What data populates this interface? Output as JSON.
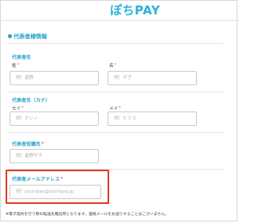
{
  "header": {
    "logo_text": "ぽちPAY"
  },
  "section": {
    "title": "代表者様情報"
  },
  "groups": {
    "name": {
      "label": "代表者名",
      "last": {
        "label": "姓",
        "required_mark": "*",
        "placeholder": "例）星野"
      },
      "first": {
        "label": "名",
        "required_mark": "*",
        "placeholder": "例）平子"
      }
    },
    "kana": {
      "label": "代表者名（カナ）",
      "last": {
        "label": "セイ",
        "required_mark": "*",
        "placeholder": "例）ホシノ"
      },
      "first": {
        "label": "メイ",
        "required_mark": "*",
        "placeholder": "例）ヒラコ"
      }
    },
    "title": {
      "label": "代表者役職名",
      "required_mark": "*",
      "placeholder": "例）星野平子"
    },
    "email": {
      "label": "代表者メールアドレス",
      "required_mark": "*",
      "placeholder": "例）pochipay@pochipay.jp"
    }
  },
  "note": "※電子契約を行う際の転送先確認用となります。連絡メールをお送りすることはございません。",
  "colors": {
    "accent": "#27a3c8",
    "logo": "#2bb3d8",
    "required": "#e53935",
    "highlight": "#e03a24"
  }
}
